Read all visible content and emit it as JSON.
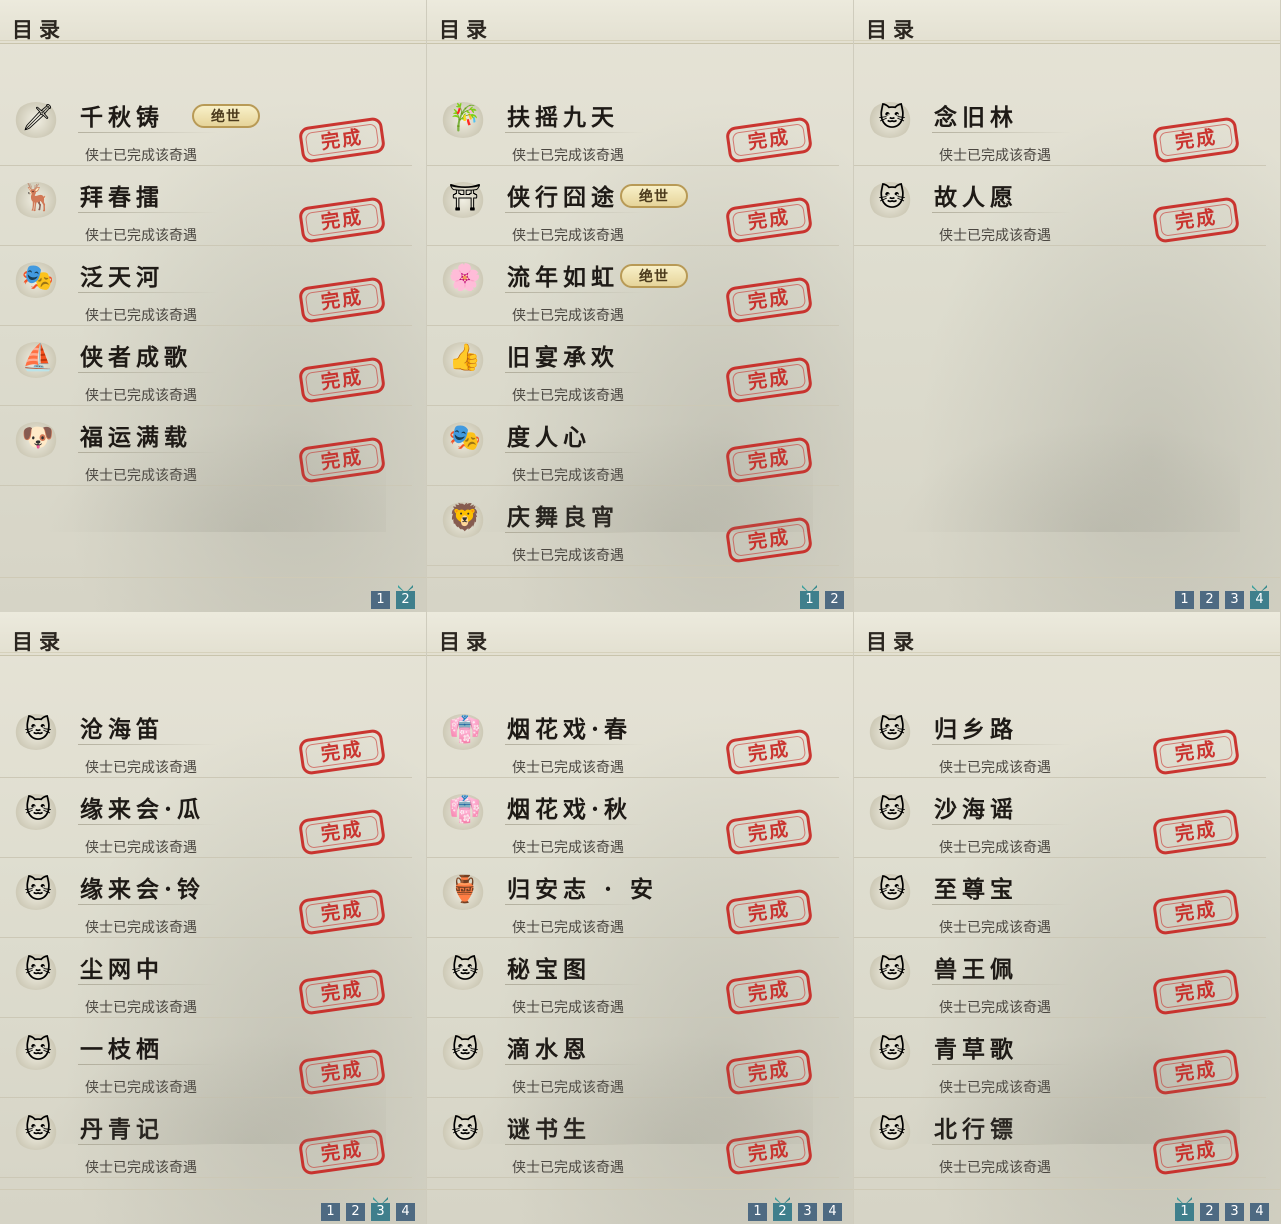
{
  "panels": [
    {
      "title": "目录",
      "entries": [
        {
          "name": "千秋铸",
          "icon": "sword-icon",
          "glyph": "🗡",
          "badge": "绝世"
        },
        {
          "name": "拜春擂",
          "icon": "deer-icon",
          "glyph": "🦌"
        },
        {
          "name": "泛天河",
          "icon": "mask-icon",
          "glyph": "🎭"
        },
        {
          "name": "侠者成歌",
          "icon": "boat-icon",
          "glyph": "⛵"
        },
        {
          "name": "福运满载",
          "icon": "dog-icon",
          "glyph": "🐶"
        }
      ],
      "status": "侠士已完成该奇遇",
      "stamp": "完成",
      "pages": [
        "1",
        "2"
      ],
      "active_page": "2"
    },
    {
      "title": "目录",
      "entries": [
        {
          "name": "扶摇九天",
          "icon": "bamboo-icon",
          "glyph": "🎋"
        },
        {
          "name": "侠行囧途",
          "icon": "pavilion-icon",
          "glyph": "⛩",
          "badge": "绝世"
        },
        {
          "name": "流年如虹",
          "icon": "flower-icon",
          "glyph": "🌸",
          "badge": "绝世"
        },
        {
          "name": "旧宴承欢",
          "icon": "thumbs-up-icon",
          "glyph": "👍"
        },
        {
          "name": "度人心",
          "icon": "white-mask-icon",
          "glyph": "🎭"
        },
        {
          "name": "庆舞良宵",
          "icon": "lion-dance-icon",
          "glyph": "🦁"
        }
      ],
      "status": "侠士已完成该奇遇",
      "stamp": "完成",
      "pages": [
        "1",
        "2"
      ],
      "active_page": "1"
    },
    {
      "title": "目录",
      "entries": [
        {
          "name": "念旧林",
          "icon": "cat-icon",
          "glyph": "🐱"
        },
        {
          "name": "故人愿",
          "icon": "cat-icon",
          "glyph": "🐱"
        }
      ],
      "status": "侠士已完成该奇遇",
      "stamp": "完成",
      "pages": [
        "1",
        "2",
        "3",
        "4"
      ],
      "active_page": "4"
    },
    {
      "title": "目录",
      "entries": [
        {
          "name": "沧海笛",
          "icon": "cat-icon",
          "glyph": "🐱"
        },
        {
          "name": "缘来会·瓜",
          "icon": "cat-icon",
          "glyph": "🐱"
        },
        {
          "name": "缘来会·铃",
          "icon": "cat-icon",
          "glyph": "🐱"
        },
        {
          "name": "尘网中",
          "icon": "cat-icon",
          "glyph": "🐱"
        },
        {
          "name": "一枝栖",
          "icon": "cat-icon",
          "glyph": "🐱"
        },
        {
          "name": "丹青记",
          "icon": "cat-icon",
          "glyph": "🐱"
        }
      ],
      "status": "侠士已完成该奇遇",
      "stamp": "完成",
      "pages": [
        "1",
        "2",
        "3",
        "4"
      ],
      "active_page": "3"
    },
    {
      "title": "目录",
      "entries": [
        {
          "name": "烟花戏·春",
          "icon": "lady-icon",
          "glyph": "👘"
        },
        {
          "name": "烟花戏·秋",
          "icon": "lady-icon",
          "glyph": "👘"
        },
        {
          "name": "归安志 · 安",
          "icon": "golden-statue-icon",
          "glyph": "🏺"
        },
        {
          "name": "秘宝图",
          "icon": "cat-icon",
          "glyph": "🐱"
        },
        {
          "name": "滴水恩",
          "icon": "cat-icon",
          "glyph": "🐱"
        },
        {
          "name": "谜书生",
          "icon": "cat-icon",
          "glyph": "🐱"
        }
      ],
      "status": "侠士已完成该奇遇",
      "stamp": "完成",
      "pages": [
        "1",
        "2",
        "3",
        "4"
      ],
      "active_page": "2"
    },
    {
      "title": "目录",
      "entries": [
        {
          "name": "归乡路",
          "icon": "cat-icon",
          "glyph": "🐱"
        },
        {
          "name": "沙海谣",
          "icon": "cat-icon",
          "glyph": "🐱"
        },
        {
          "name": "至尊宝",
          "icon": "cat-icon",
          "glyph": "🐱"
        },
        {
          "name": "兽王佩",
          "icon": "cat-icon",
          "glyph": "🐱"
        },
        {
          "name": "青草歌",
          "icon": "cat-icon",
          "glyph": "🐱"
        },
        {
          "name": "北行镖",
          "icon": "cat-icon",
          "glyph": "🐱"
        }
      ],
      "status": "侠士已完成该奇遇",
      "stamp": "完成",
      "pages": [
        "1",
        "2",
        "3",
        "4"
      ],
      "active_page": "1"
    }
  ]
}
